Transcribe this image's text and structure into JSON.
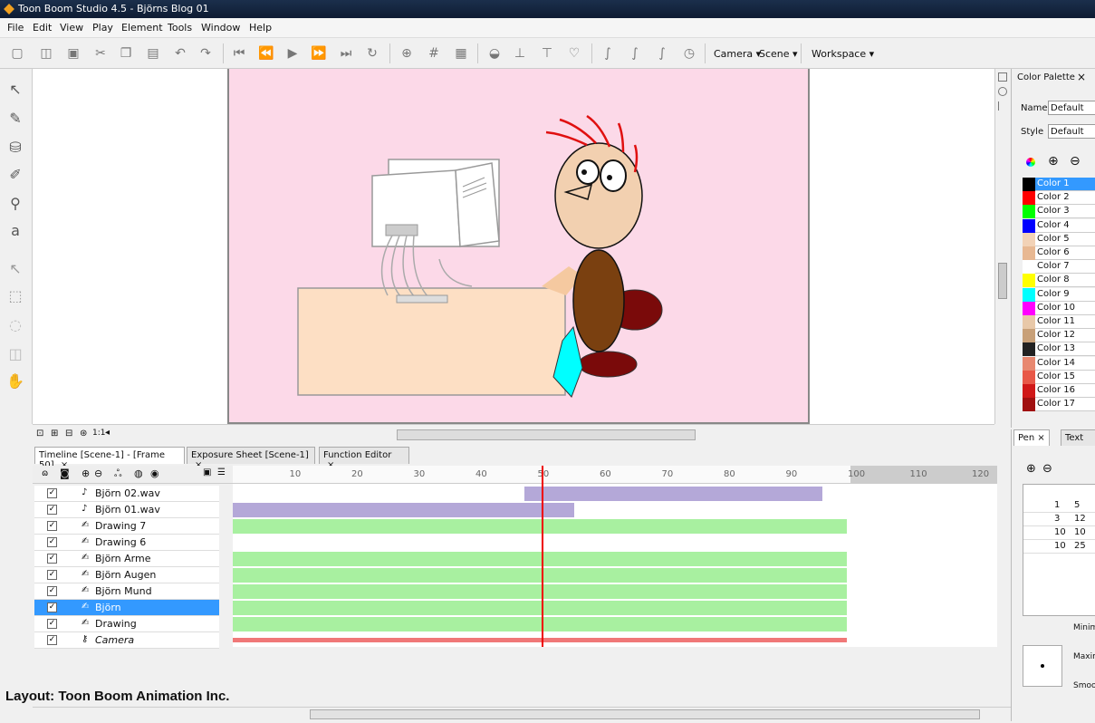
{
  "window": {
    "title": "Toon Boom Studio 4.5 - Björns Blog 01"
  },
  "menu": [
    "File",
    "Edit",
    "View",
    "Play",
    "Element",
    "Tools",
    "Window",
    "Help"
  ],
  "toolbar": {
    "camera": "Camera",
    "scene": "Scene",
    "workspace": "Workspace"
  },
  "palette": {
    "title": "Color Palette",
    "name_label": "Name",
    "name_value": "Default",
    "style_label": "Style",
    "style_value": "Default",
    "colors": [
      {
        "name": "Color 1",
        "hex": "#000000"
      },
      {
        "name": "Color 2",
        "hex": "#ff0000"
      },
      {
        "name": "Color 3",
        "hex": "#00ff00"
      },
      {
        "name": "Color 4",
        "hex": "#0000ff"
      },
      {
        "name": "Color 5",
        "hex": "#f2d2b6"
      },
      {
        "name": "Color 6",
        "hex": "#e8b892"
      },
      {
        "name": "Color 7",
        "hex": "#ffffff"
      },
      {
        "name": "Color 8",
        "hex": "#ffff00"
      },
      {
        "name": "Color 9",
        "hex": "#00ffff"
      },
      {
        "name": "Color 10",
        "hex": "#ff00ff"
      },
      {
        "name": "Color 11",
        "hex": "#e8c8a8"
      },
      {
        "name": "Color 12",
        "hex": "#c8a078"
      },
      {
        "name": "Color 13",
        "hex": "#222222"
      },
      {
        "name": "Color 14",
        "hex": "#e88870"
      },
      {
        "name": "Color 15",
        "hex": "#e85848"
      },
      {
        "name": "Color 16",
        "hex": "#d01818"
      },
      {
        "name": "Color 17",
        "hex": "#a01010"
      }
    ]
  },
  "pen_panel": {
    "tab_pen": "Pen",
    "tab_text": "Text",
    "rows": [
      [
        "1",
        "5"
      ],
      [
        "3",
        "12"
      ],
      [
        "10",
        "10"
      ],
      [
        "10",
        "25"
      ]
    ],
    "minimum": "Minim",
    "maximum": "Maxim",
    "smoothness": "Smoot"
  },
  "timeline": {
    "tabs": [
      "Timeline [Scene-1] - [Frame 50]",
      "Exposure Sheet [Scene-1]",
      "Function Editor"
    ],
    "ruler": [
      "10",
      "20",
      "30",
      "40",
      "50",
      "60",
      "70",
      "80",
      "90",
      "100",
      "110",
      "120"
    ],
    "layers": [
      {
        "name": "Björn 02.wav",
        "icon": "sound-icon",
        "selected": false
      },
      {
        "name": "Björn 01.wav",
        "icon": "sound-icon",
        "selected": false
      },
      {
        "name": "Drawing 7",
        "icon": "drawing-icon",
        "selected": false
      },
      {
        "name": "Drawing 6",
        "icon": "drawing-icon",
        "selected": false
      },
      {
        "name": "Björn Arme",
        "icon": "drawing-icon",
        "selected": false
      },
      {
        "name": "Björn Augen",
        "icon": "drawing-icon",
        "selected": false
      },
      {
        "name": "Björn Mund",
        "icon": "drawing-icon",
        "selected": false
      },
      {
        "name": "Björn",
        "icon": "drawing-icon",
        "selected": true
      },
      {
        "name": "Drawing",
        "icon": "drawing-icon",
        "selected": false
      },
      {
        "name": "Camera",
        "icon": "camera-icon",
        "selected": false
      }
    ],
    "current_frame": 50
  },
  "watermark": "Layout: Toon Boom Animation Inc."
}
